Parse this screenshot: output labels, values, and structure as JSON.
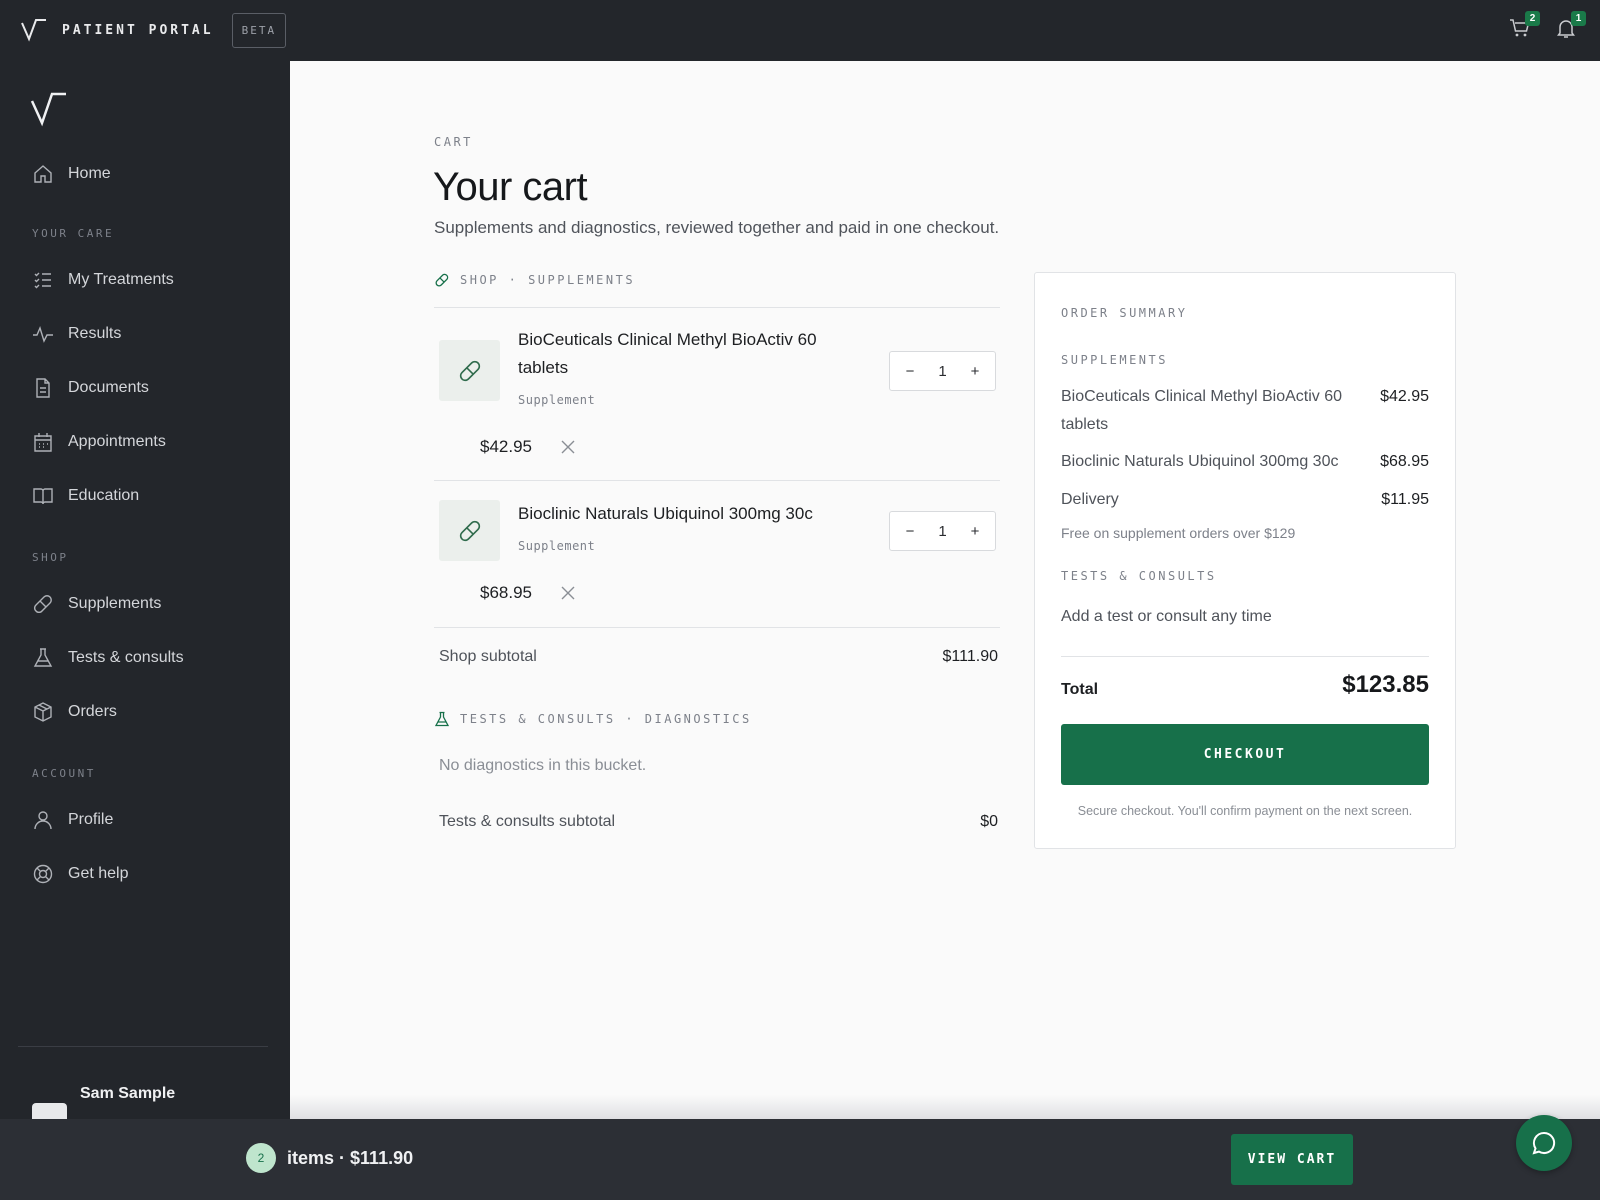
{
  "topbar": {
    "brand": "PATIENT PORTAL",
    "beta": "BETA",
    "cart_badge": "2",
    "notifications_badge": "1"
  },
  "sidebar": {
    "home": "Home",
    "section_care": "YOUR CARE",
    "care_items": [
      "My Treatments",
      "Results",
      "Documents",
      "Appointments",
      "Education"
    ],
    "section_shop": "SHOP",
    "shop_items": [
      "Supplements",
      "Tests & consults",
      "Orders"
    ],
    "section_account": "ACCOUNT",
    "account_items": [
      "Profile",
      "Get help"
    ],
    "user_name": "Sam Sample"
  },
  "main": {
    "eyebrow": "CART",
    "title": "Your cart",
    "subtitle": "Supplements and diagnostics, reviewed together and paid in one checkout.",
    "shop_section": "SHOP · SUPPLEMENTS",
    "items": [
      {
        "name": "BioCeuticals Clinical Methyl BioActiv 60 tablets",
        "type": "Supplement",
        "qty": "1",
        "price": "$42.95"
      },
      {
        "name": "Bioclinic Naturals Ubiquinol 300mg 30c",
        "type": "Supplement",
        "qty": "1",
        "price": "$68.95"
      }
    ],
    "shop_subtotal_label": "Shop subtotal",
    "shop_subtotal_value": "$111.90",
    "tests_section": "TESTS & CONSULTS · DIAGNOSTICS",
    "tests_empty": "No diagnostics in this bucket.",
    "tests_subtotal_label": "Tests & consults subtotal",
    "tests_subtotal_value": "$0",
    "qty_minus": "−",
    "qty_plus": "+"
  },
  "summary": {
    "heading": "ORDER SUMMARY",
    "supplements_heading": "SUPPLEMENTS",
    "lines": [
      {
        "label": "BioCeuticals Clinical Methyl BioActiv 60 tablets",
        "value": "$42.95"
      },
      {
        "label": "Bioclinic Naturals Ubiquinol 300mg 30c",
        "value": "$68.95"
      }
    ],
    "delivery_label": "Delivery",
    "delivery_value": "$11.95",
    "delivery_note": "Free on supplement orders over $129",
    "tests_heading": "TESTS & CONSULTS",
    "tests_note": "Add a test or consult any time",
    "total_label": "Total",
    "total_value": "$123.85",
    "checkout": "CHECKOUT",
    "secure_note": "Secure checkout. You'll confirm payment on the next screen."
  },
  "bottombar": {
    "count": "2",
    "text": "items · $111.90",
    "view_cart": "VIEW CART"
  },
  "colors": {
    "accent": "#17704a",
    "sidebar_bg": "#23262b",
    "badge_bg": "#1a7a49"
  }
}
